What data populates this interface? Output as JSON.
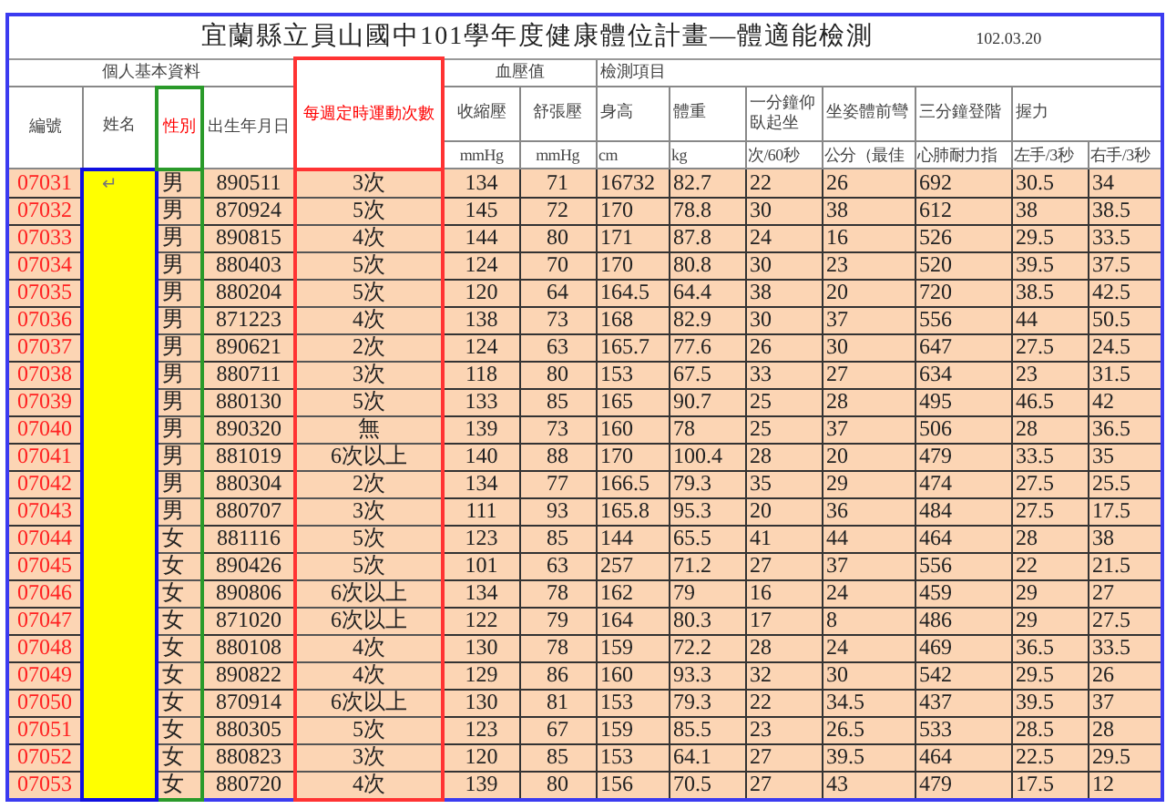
{
  "title": "宜蘭縣立員山國中101學年度健康體位計畫—體適能檢測",
  "date": "102.03.20",
  "groups": [
    {
      "label": "個人基本資料",
      "kind": "group"
    },
    {
      "label": "每週定時運動次數",
      "kind": "exercise"
    },
    {
      "label": "血壓值",
      "kind": "group"
    },
    {
      "label": "檢測項目",
      "kind": "group"
    }
  ],
  "columns": [
    {
      "label": "編號",
      "kind": "id"
    },
    {
      "label": "姓名",
      "kind": "name"
    },
    {
      "label": "性別",
      "kind": "sex"
    },
    {
      "label": "出生年月日",
      "kind": "birth"
    },
    {
      "label": "收縮壓",
      "unit": "mmHg"
    },
    {
      "label": "舒張壓",
      "unit": "mmHg"
    },
    {
      "label": "身高",
      "unit": "cm"
    },
    {
      "label": "體重",
      "unit": "kg"
    },
    {
      "label": "一分鐘仰臥起坐",
      "unit": "次/60秒"
    },
    {
      "label": "坐姿體前彎",
      "unit": "公分（最佳"
    },
    {
      "label": "三分鐘登階",
      "unit": "心肺耐力指"
    },
    {
      "label": "握力",
      "unit": "左手/3秒"
    },
    {
      "unit": "右手/3秒"
    }
  ],
  "rows": [
    {
      "id": "07031",
      "name": "↵",
      "sex": "男",
      "birth": "890511",
      "exercise": "3次",
      "values": [
        "134",
        "71",
        "16732",
        "82.7",
        "22",
        "26",
        "692",
        "30.5",
        "34"
      ]
    },
    {
      "id": "07032",
      "sex": "男",
      "birth": "870924",
      "exercise": "5次",
      "values": [
        "145",
        "72",
        "170",
        "78.8",
        "30",
        "38",
        "612",
        "38",
        "38.5"
      ]
    },
    {
      "id": "07033",
      "sex": "男",
      "birth": "890815",
      "exercise": "4次",
      "values": [
        "144",
        "80",
        "171",
        "87.8",
        "24",
        "16",
        "526",
        "29.5",
        "33.5"
      ]
    },
    {
      "id": "07034",
      "sex": "男",
      "birth": "880403",
      "exercise": "5次",
      "values": [
        "124",
        "70",
        "170",
        "80.8",
        "30",
        "23",
        "520",
        "39.5",
        "37.5"
      ]
    },
    {
      "id": "07035",
      "sex": "男",
      "birth": "880204",
      "exercise": "5次",
      "values": [
        "120",
        "64",
        "164.5",
        "64.4",
        "38",
        "20",
        "720",
        "38.5",
        "42.5"
      ]
    },
    {
      "id": "07036",
      "sex": "男",
      "birth": "871223",
      "exercise": "4次",
      "values": [
        "138",
        "73",
        "168",
        "82.9",
        "30",
        "37",
        "556",
        "44",
        "50.5"
      ]
    },
    {
      "id": "07037",
      "sex": "男",
      "birth": "890621",
      "exercise": "2次",
      "values": [
        "124",
        "63",
        "165.7",
        "77.6",
        "26",
        "30",
        "647",
        "27.5",
        "24.5"
      ]
    },
    {
      "id": "07038",
      "sex": "男",
      "birth": "880711",
      "exercise": "3次",
      "values": [
        "118",
        "80",
        "153",
        "67.5",
        "33",
        "27",
        "634",
        "23",
        "31.5"
      ]
    },
    {
      "id": "07039",
      "sex": "男",
      "birth": "880130",
      "exercise": "5次",
      "values": [
        "133",
        "85",
        "165",
        "90.7",
        "25",
        "28",
        "495",
        "46.5",
        "42"
      ]
    },
    {
      "id": "07040",
      "sex": "男",
      "birth": "890320",
      "exercise": "無",
      "values": [
        "139",
        "73",
        "160",
        "78",
        "25",
        "37",
        "506",
        "28",
        "36.5"
      ]
    },
    {
      "id": "07041",
      "sex": "男",
      "birth": "881019",
      "exercise": "6次以上",
      "values": [
        "140",
        "88",
        "170",
        "100.4",
        "28",
        "20",
        "479",
        "33.5",
        "35"
      ]
    },
    {
      "id": "07042",
      "sex": "男",
      "birth": "880304",
      "exercise": "2次",
      "values": [
        "134",
        "77",
        "166.5",
        "79.3",
        "35",
        "29",
        "474",
        "27.5",
        "25.5"
      ]
    },
    {
      "id": "07043",
      "sex": "男",
      "birth": "880707",
      "exercise": "3次",
      "values": [
        "111",
        "93",
        "165.8",
        "95.3",
        "20",
        "36",
        "484",
        "27.5",
        "17.5"
      ]
    },
    {
      "id": "07044",
      "sex": "女",
      "birth": "881116",
      "exercise": "5次",
      "values": [
        "123",
        "85",
        "144",
        "65.5",
        "41",
        "44",
        "464",
        "28",
        "38"
      ]
    },
    {
      "id": "07045",
      "sex": "女",
      "birth": "890426",
      "exercise": "5次",
      "values": [
        "101",
        "63",
        "257",
        "71.2",
        "27",
        "37",
        "556",
        "22",
        "21.5"
      ]
    },
    {
      "id": "07046",
      "sex": "女",
      "birth": "890806",
      "exercise": "6次以上",
      "values": [
        "134",
        "78",
        "162",
        "79",
        "16",
        "24",
        "459",
        "29",
        "27"
      ]
    },
    {
      "id": "07047",
      "sex": "女",
      "birth": "871020",
      "exercise": "6次以上",
      "values": [
        "122",
        "79",
        "164",
        "80.3",
        "17",
        "8",
        "486",
        "29",
        "27.5"
      ]
    },
    {
      "id": "07048",
      "sex": "女",
      "birth": "880108",
      "exercise": "4次",
      "values": [
        "130",
        "78",
        "159",
        "72.2",
        "28",
        "24",
        "469",
        "36.5",
        "33.5"
      ]
    },
    {
      "id": "07049",
      "sex": "女",
      "birth": "890822",
      "exercise": "4次",
      "values": [
        "129",
        "86",
        "160",
        "93.3",
        "32",
        "30",
        "542",
        "29.5",
        "26"
      ]
    },
    {
      "id": "07050",
      "sex": "女",
      "birth": "870914",
      "exercise": "6次以上",
      "values": [
        "130",
        "81",
        "153",
        "79.3",
        "22",
        "34.5",
        "437",
        "39.5",
        "37"
      ]
    },
    {
      "id": "07051",
      "sex": "女",
      "birth": "880305",
      "exercise": "5次",
      "values": [
        "123",
        "67",
        "159",
        "85.5",
        "23",
        "26.5",
        "533",
        "28.5",
        "28"
      ]
    },
    {
      "id": "07052",
      "sex": "女",
      "birth": "880823",
      "exercise": "3次",
      "values": [
        "120",
        "85",
        "153",
        "64.1",
        "27",
        "39.5",
        "464",
        "22.5",
        "29.5"
      ]
    },
    {
      "id": "07053",
      "sex": "女",
      "birth": "880720",
      "exercise": "4次",
      "values": [
        "139",
        "80",
        "156",
        "70.5",
        "27",
        "43",
        "479",
        "17.5",
        "12"
      ]
    }
  ]
}
